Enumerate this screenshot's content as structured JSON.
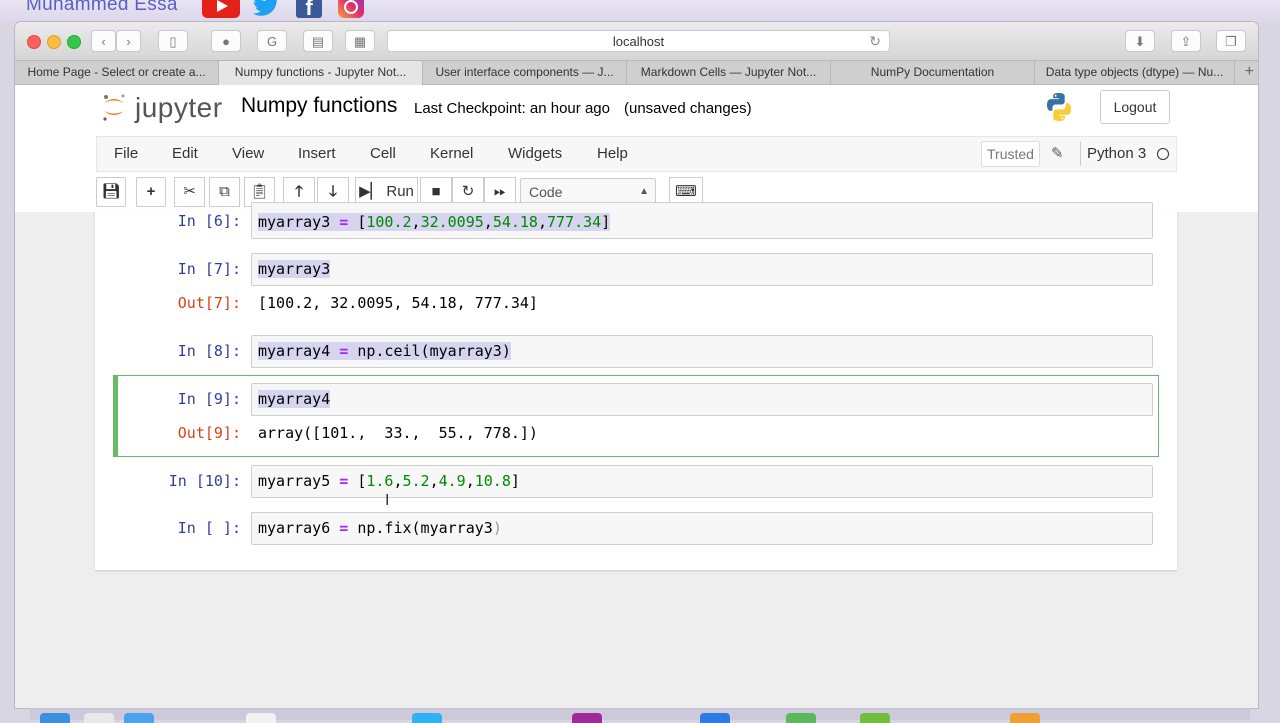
{
  "overlay": {
    "channel_name": "Muhammed Essa",
    "socials": [
      "youtube-icon",
      "twitter-icon",
      "facebook-icon",
      "instagram-icon"
    ]
  },
  "browser": {
    "url": "localhost",
    "tabs": [
      {
        "label": "Home Page - Select or create a...",
        "active": false
      },
      {
        "label": "Numpy functions - Jupyter Not...",
        "active": true
      },
      {
        "label": "User interface components — J...",
        "active": false
      },
      {
        "label": "Markdown Cells — Jupyter Not...",
        "active": false
      },
      {
        "label": "NumPy Documentation",
        "active": false
      },
      {
        "label": "Data type objects (dtype) — Nu...",
        "active": false
      }
    ]
  },
  "jupyter": {
    "logo_text": "jupyter",
    "notebook_name": "Numpy functions",
    "checkpoint": "Last Checkpoint: an hour ago",
    "save_status": "(unsaved changes)",
    "logout_label": "Logout",
    "menu": [
      "File",
      "Edit",
      "View",
      "Insert",
      "Cell",
      "Kernel",
      "Widgets",
      "Help"
    ],
    "trusted_label": "Trusted",
    "kernel_name": "Python 3",
    "toolbar": {
      "run_label": "Run",
      "cell_type": "Code"
    }
  },
  "cells": [
    {
      "prompt": "In [6]:",
      "code": "myarray3 = [100.2,32.0095,54.18,777.34]",
      "output_prompt": "",
      "output": ""
    },
    {
      "prompt": "In [7]:",
      "code": "myarray3",
      "output_prompt": "Out[7]:",
      "output": "[100.2, 32.0095, 54.18, 777.34]"
    },
    {
      "prompt": "In [8]:",
      "code": "myarray4 = np.ceil(myarray3)",
      "output_prompt": "",
      "output": ""
    },
    {
      "prompt": "In [9]:",
      "code": "myarray4",
      "output_prompt": "Out[9]:",
      "output": "array([101.,  33.,  55., 778.])"
    },
    {
      "prompt": "In [10]:",
      "code": "myarray5 = [1.6,5.2,4.9,10.8]",
      "output_prompt": "",
      "output": ""
    },
    {
      "prompt": "In [ ]:",
      "code": "myarray6 = np.fix(myarray3)",
      "output_prompt": "",
      "output": ""
    }
  ]
}
